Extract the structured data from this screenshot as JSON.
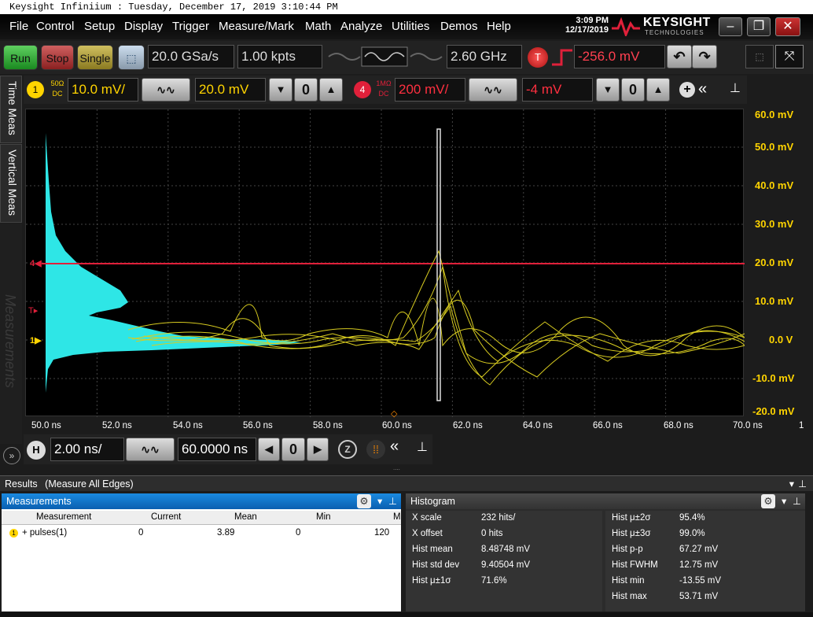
{
  "title_bar": "Keysight Infiniium : Tuesday, December 17, 2019 3:10:44 PM",
  "menu": [
    "File",
    "Control",
    "Setup",
    "Display",
    "Trigger",
    "Measure/Mark",
    "Math",
    "Analyze",
    "Utilities",
    "Demos",
    "Help"
  ],
  "clock": {
    "time": "3:09 PM",
    "date": "12/17/2019"
  },
  "brand": {
    "name": "KEYSIGHT",
    "sub": "TECHNOLOGIES"
  },
  "toolbar": {
    "run": "Run",
    "stop": "Stop",
    "single": "Single",
    "sample_rate": "20.0 GSa/s",
    "points": "1.00 kpts",
    "bandwidth": "2.60 GHz",
    "trigger_label": "T",
    "trigger_level": "-256.0 mV"
  },
  "channels": {
    "ch1": {
      "num": "1",
      "coupling_top": "50Ω",
      "coupling_bot": "DC",
      "scale": "10.0 mV/",
      "offset": "20.0 mV",
      "color": "#ffd400"
    },
    "ch4": {
      "num": "4",
      "coupling_top": "1MΩ",
      "coupling_bot": "DC",
      "scale": "200 mV/",
      "offset": "-4 mV",
      "color": "#e0203a"
    }
  },
  "side_tabs": {
    "time_meas": "Time Meas",
    "vertical_meas": "Vertical Meas",
    "measurements": "Measurements"
  },
  "y_axis": [
    "60.0 mV",
    "50.0 mV",
    "40.0 mV",
    "30.0 mV",
    "20.0 mV",
    "10.0 mV",
    "0.0 V",
    "-10.0 mV",
    "-20.0 mV"
  ],
  "x_axis": [
    "50.0 ns",
    "52.0 ns",
    "54.0 ns",
    "56.0 ns",
    "58.0 ns",
    "60.0 ns",
    "62.0 ns",
    "64.0 ns",
    "66.0 ns",
    "68.0 ns",
    "70.0 ns"
  ],
  "x_axis_extra": "1",
  "horizontal": {
    "label": "H",
    "scale": "2.00 ns/",
    "position": "60.0000 ns"
  },
  "results": {
    "title": "Results",
    "subtitle": "(Measure All Edges)"
  },
  "measurements": {
    "title": "Measurements",
    "columns": [
      "Measurement",
      "Current",
      "Mean",
      "Min",
      "M"
    ],
    "rows": [
      {
        "name": "+ pulses(1)",
        "current": "0",
        "mean": "3.89",
        "min": "0",
        "max": "120"
      }
    ]
  },
  "histogram": {
    "title": "Histogram",
    "left": [
      {
        "k": "X scale",
        "v": "232 hits/"
      },
      {
        "k": "X offset",
        "v": "0 hits"
      },
      {
        "k": "Hist mean",
        "v": "8.48748 mV"
      },
      {
        "k": "Hist std dev",
        "v": "9.40504 mV"
      },
      {
        "k": "Hist μ±1σ",
        "v": "71.6%"
      }
    ],
    "right": [
      {
        "k": "Hist μ±2σ",
        "v": "95.4%"
      },
      {
        "k": "Hist μ±3σ",
        "v": "99.0%"
      },
      {
        "k": "Hist p-p",
        "v": "67.27 mV"
      },
      {
        "k": "Hist FWHM",
        "v": "12.75 mV"
      },
      {
        "k": "Hist min",
        "v": "-13.55 mV"
      },
      {
        "k": "Hist max",
        "v": "53.71 mV"
      }
    ]
  }
}
